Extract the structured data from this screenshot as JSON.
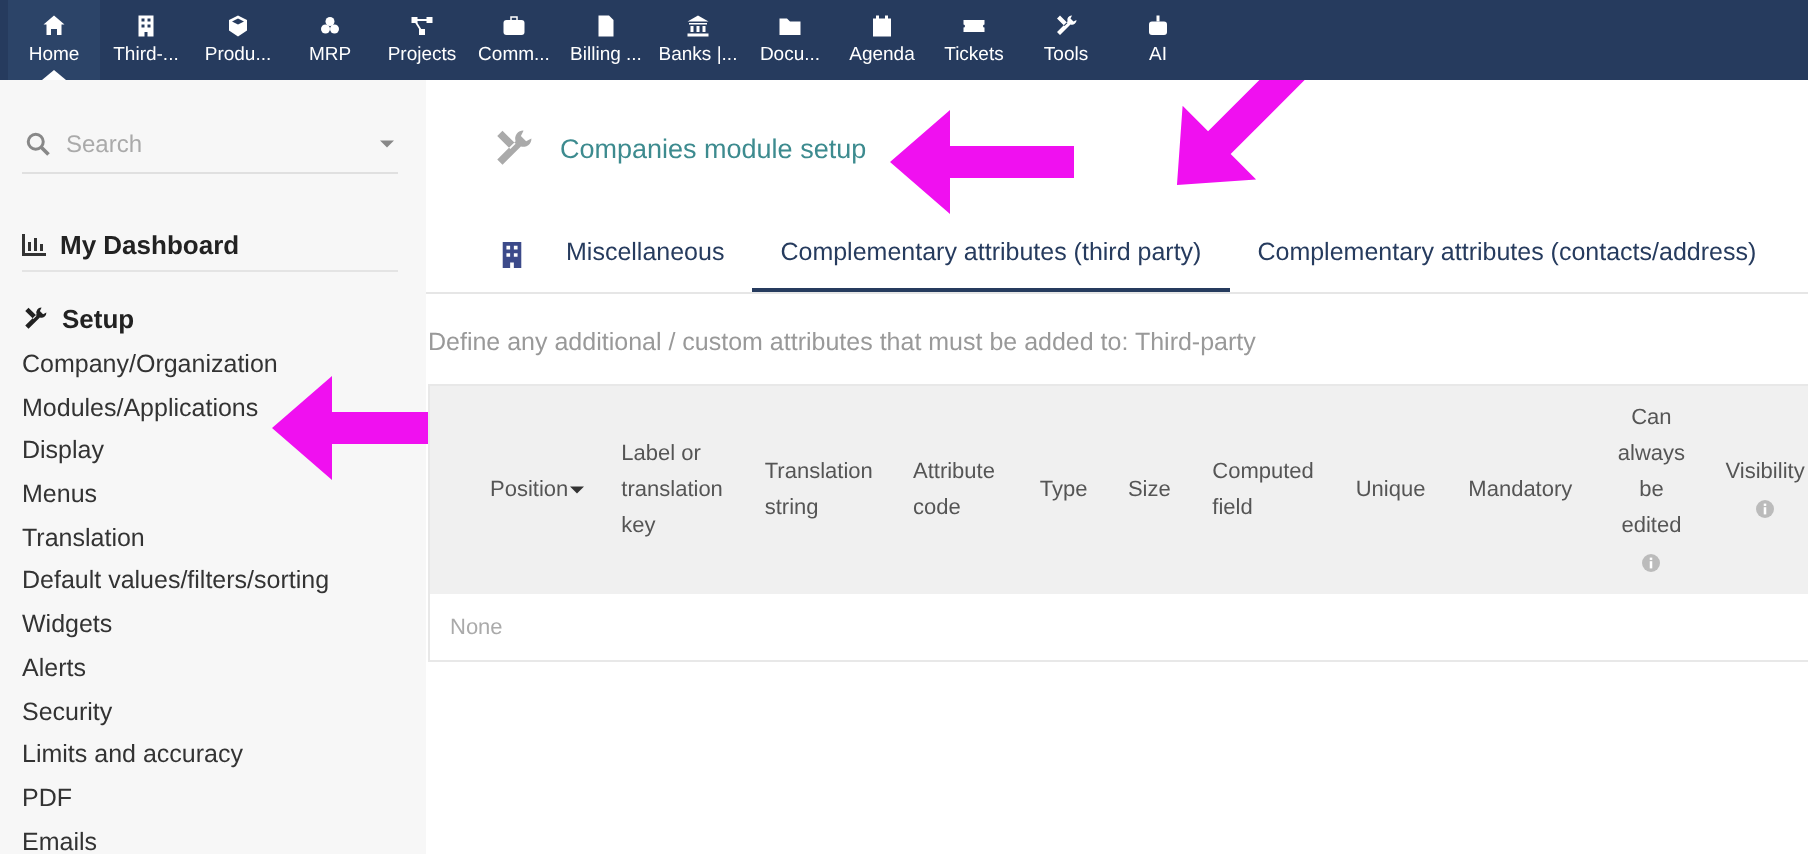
{
  "top_menu": [
    {
      "label": "Home",
      "selected": true
    },
    {
      "label": "Third-...",
      "selected": false
    },
    {
      "label": "Produ...",
      "selected": false
    },
    {
      "label": "MRP",
      "selected": false
    },
    {
      "label": "Projects",
      "selected": false
    },
    {
      "label": "Comm...",
      "selected": false
    },
    {
      "label": "Billing ...",
      "selected": false
    },
    {
      "label": "Banks |...",
      "selected": false
    },
    {
      "label": "Docu...",
      "selected": false
    },
    {
      "label": "Agenda",
      "selected": false
    },
    {
      "label": "Tickets",
      "selected": false
    },
    {
      "label": "Tools",
      "selected": false
    },
    {
      "label": "AI",
      "selected": false
    }
  ],
  "sidebar": {
    "search": {
      "placeholder": "Search"
    },
    "dashboard": "My Dashboard",
    "section": "Setup",
    "items": [
      {
        "label": "Company/Organization",
        "marked": false
      },
      {
        "label": "Modules/Applications",
        "marked": true
      },
      {
        "label": "Display",
        "marked": false
      },
      {
        "label": "Menus",
        "marked": false
      },
      {
        "label": "Translation",
        "marked": false
      },
      {
        "label": "Default values/filters/sorting",
        "marked": false
      },
      {
        "label": "Widgets",
        "marked": false
      },
      {
        "label": "Alerts",
        "marked": false
      },
      {
        "label": "Security",
        "marked": false
      },
      {
        "label": "Limits and accuracy",
        "marked": false
      },
      {
        "label": "PDF",
        "marked": false
      },
      {
        "label": "Emails",
        "marked": false
      }
    ]
  },
  "page": {
    "title": "Companies module setup",
    "title_marked": true,
    "tabs": [
      {
        "label": "Miscellaneous",
        "selected": false,
        "marked": false
      },
      {
        "label": "Complementary attributes (third party)",
        "selected": true,
        "marked": true
      },
      {
        "label": "Complementary attributes (contacts/address)",
        "selected": false,
        "marked": false
      }
    ],
    "description": "Define any additional / custom attributes that must be added to: Third-party",
    "table": {
      "columns": [
        {
          "label": "Position",
          "sorted": true,
          "info": false
        },
        {
          "label": "Label or translation key",
          "sorted": false,
          "info": false
        },
        {
          "label": "Translation string",
          "sorted": false,
          "info": false
        },
        {
          "label": "Attribute code",
          "sorted": false,
          "info": false
        },
        {
          "label": "Type",
          "sorted": false,
          "info": false
        },
        {
          "label": "Size",
          "sorted": false,
          "info": false
        },
        {
          "label": "Computed field",
          "sorted": false,
          "info": false
        },
        {
          "label": "Unique",
          "sorted": false,
          "info": false
        },
        {
          "label": "Mandatory",
          "sorted": false,
          "info": false
        },
        {
          "label": "Can always be edited",
          "sorted": false,
          "info": true
        },
        {
          "label": "Visibility",
          "sorted": false,
          "info": true
        }
      ],
      "empty_text": "None"
    }
  }
}
